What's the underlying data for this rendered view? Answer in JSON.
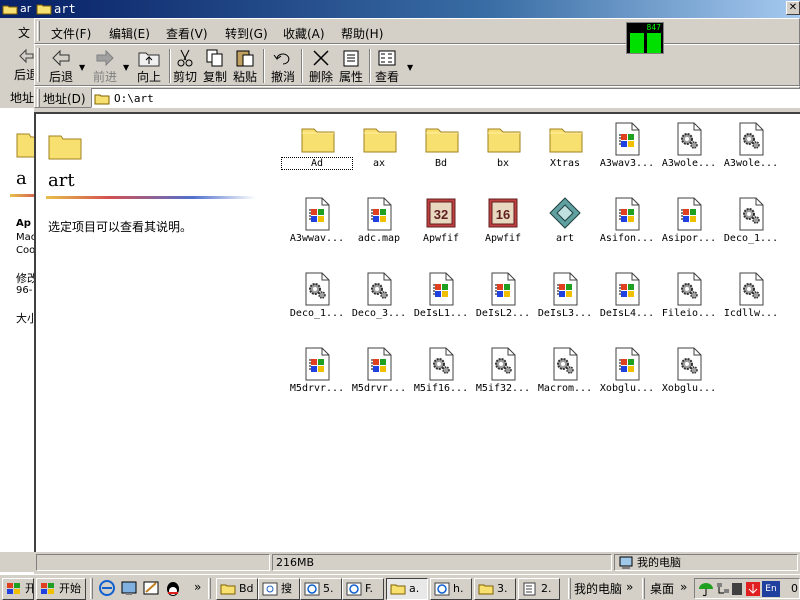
{
  "back_window": {
    "title": "ar",
    "menu_first": "文",
    "toolbar_first": "后退",
    "addr_label": "地址",
    "web_title": "a",
    "web_lines": [
      "Ap",
      "Mac",
      "Coo",
      "修改",
      "96-",
      "大小"
    ]
  },
  "window": {
    "title": "art",
    "close_glyph": "✕"
  },
  "menu": [
    {
      "label": "文件(F)"
    },
    {
      "label": "编辑(E)"
    },
    {
      "label": "查看(V)"
    },
    {
      "label": "转到(G)"
    },
    {
      "label": "收藏(A)"
    },
    {
      "label": "帮助(H)"
    }
  ],
  "toolbar": {
    "back": "后退",
    "forward": "前进",
    "up": "向上",
    "cut": "剪切",
    "copy": "复制",
    "paste": "粘贴",
    "undo": "撤消",
    "delete": "删除",
    "properties": "属性",
    "view": "查看"
  },
  "address": {
    "label": "地址(D)",
    "value": "O:\\art"
  },
  "webview": {
    "title": "art",
    "hint": "选定项目可以查看其说明。"
  },
  "files": [
    {
      "name": "Ad",
      "icon": "folder-icon"
    },
    {
      "name": "ax",
      "icon": "folder-icon"
    },
    {
      "name": "Bd",
      "icon": "folder-icon"
    },
    {
      "name": "bx",
      "icon": "folder-icon"
    },
    {
      "name": "Xtras",
      "icon": "folder-icon"
    },
    {
      "name": "A3wav3...",
      "icon": "windows-file-icon"
    },
    {
      "name": "A3wole...",
      "icon": "gear-file-icon"
    },
    {
      "name": "A3wole...",
      "icon": "gear-file-icon"
    },
    {
      "name": "A3wwav...",
      "icon": "windows-file-icon"
    },
    {
      "name": "adc.map",
      "icon": "windows-file-icon"
    },
    {
      "name": "Apwfif",
      "icon": "app-32-icon",
      "badge": "32"
    },
    {
      "name": "Apwfif",
      "icon": "app-16-icon",
      "badge": "16"
    },
    {
      "name": "art",
      "icon": "diamond-app-icon"
    },
    {
      "name": "Asifon...",
      "icon": "windows-file-icon"
    },
    {
      "name": "Asipor...",
      "icon": "windows-file-icon"
    },
    {
      "name": "Deco_1...",
      "icon": "gear-file-icon"
    },
    {
      "name": "Deco_1...",
      "icon": "gear-file-icon"
    },
    {
      "name": "Deco_3...",
      "icon": "gear-file-icon"
    },
    {
      "name": "DeIsL1...",
      "icon": "windows-file-icon"
    },
    {
      "name": "DeIsL2...",
      "icon": "windows-file-icon"
    },
    {
      "name": "DeIsL3...",
      "icon": "windows-file-icon"
    },
    {
      "name": "DeIsL4...",
      "icon": "windows-file-icon"
    },
    {
      "name": "Fileio...",
      "icon": "gear-file-icon"
    },
    {
      "name": "Icdllw...",
      "icon": "gear-file-icon"
    },
    {
      "name": "M5drvr...",
      "icon": "windows-file-icon"
    },
    {
      "name": "M5drvr...",
      "icon": "windows-file-icon"
    },
    {
      "name": "M5if16...",
      "icon": "gear-file-icon"
    },
    {
      "name": "M5if32...",
      "icon": "gear-file-icon"
    },
    {
      "name": "Macrom...",
      "icon": "gear-file-icon"
    },
    {
      "name": "Xobglu...",
      "icon": "windows-file-icon"
    },
    {
      "name": "Xobglu...",
      "icon": "gear-file-icon"
    }
  ],
  "status": {
    "size": "216MB",
    "zone": "我的电脑"
  },
  "taskbar": {
    "start_left": "开",
    "start": "开始",
    "more": "»",
    "tasks": [
      {
        "label": "Bd"
      },
      {
        "label": "搜"
      },
      {
        "label": "5."
      },
      {
        "label": "F."
      },
      {
        "label": "a."
      },
      {
        "label": "h."
      },
      {
        "label": "3."
      },
      {
        "label": "2."
      }
    ],
    "my_computer": "我的电脑",
    "desktop": "桌面",
    "ime": "En",
    "clock": "0"
  },
  "gadget": {
    "text": "847"
  },
  "colors": {
    "title_active": "#0a246a",
    "face": "#d4d0c8",
    "highlight_folder": "#f8e070"
  }
}
